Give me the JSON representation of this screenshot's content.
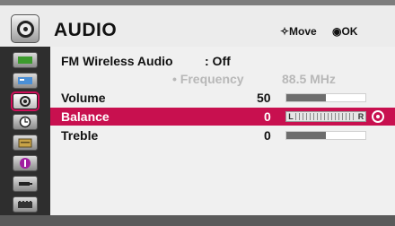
{
  "header": {
    "title": "AUDIO",
    "move_hint": "✧Move",
    "ok_hint": "◉OK"
  },
  "sidebar": {
    "items": [
      {
        "icon": "picture-icon",
        "color": "#3c9b2d"
      },
      {
        "icon": "screen-icon",
        "color": "#4a8fd6"
      },
      {
        "icon": "audio-icon",
        "active": true
      },
      {
        "icon": "time-icon"
      },
      {
        "icon": "setup-icon",
        "color": "#c8a347"
      },
      {
        "icon": "option-icon",
        "color": "#a01ea0"
      },
      {
        "icon": "input-icon"
      },
      {
        "icon": "lock-icon"
      }
    ]
  },
  "menu": {
    "fm_label": "FM Wireless Audio",
    "fm_value": ": Off",
    "frequency_label": "• Frequency",
    "frequency_value": "88.5 MHz",
    "volume_label": "Volume",
    "volume_value": "50",
    "volume_level_percent": 50,
    "balance_label": "Balance",
    "balance_value": "0",
    "balance_left": "L",
    "balance_right": "R",
    "treble_label": "Treble",
    "treble_value": "0",
    "treble_level_percent": 50
  },
  "colors": {
    "selected_row": "#c8104f",
    "header_bg": "#ececec",
    "sidebar_bg": "#2e2e2e",
    "disabled_text": "#b8b8b8"
  }
}
